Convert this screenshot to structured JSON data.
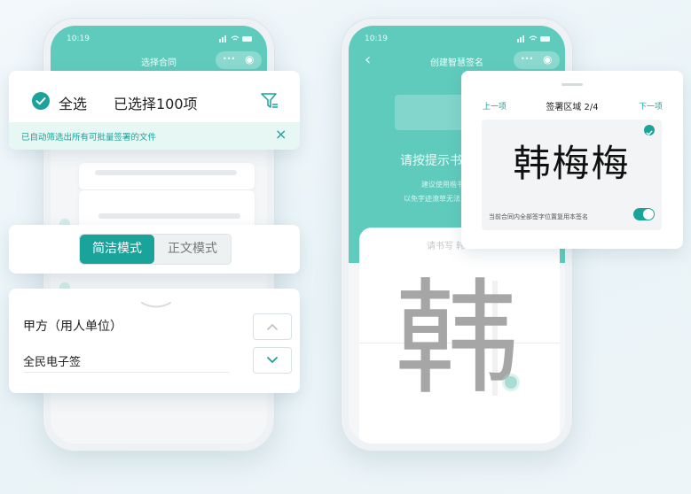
{
  "left_phone": {
    "time": "10:19",
    "title": "选择合同",
    "menu_glyph": "•••",
    "target_glyph": "◉"
  },
  "right_phone": {
    "time": "10:19",
    "back_glyph": "‹",
    "title": "创建智慧签名",
    "menu_glyph": "•••",
    "target_glyph": "◉",
    "hint_title_partial": "请按提示书写",
    "hint_line1_partial": "建议使用楷书",
    "hint_line2_partial": "以免字迹潦草无法",
    "write_label_partial": "请书写 韩",
    "big_char": "韩"
  },
  "select_card": {
    "select_all_label": "全选",
    "selected_text": "已选择100项",
    "banner_text": "已自动筛选出所有可批量签署的文件",
    "close_glyph": "×"
  },
  "mode_card": {
    "tabs": [
      {
        "label": "简洁模式",
        "active": true
      },
      {
        "label": "正文模式",
        "active": false
      }
    ]
  },
  "party_card": {
    "party_label": "甲方（用人单位）",
    "party_value": "全民电子签"
  },
  "sign_card": {
    "prev_label": "上一项",
    "area_label": "签署区域 2/4",
    "next_label": "下一项",
    "signature_text": "韩梅梅",
    "reuse_label": "当前合同内全部签字位置复用本签名",
    "reuse_on": true
  },
  "colors": {
    "accent": "#1aa39a",
    "teal_header": "#5fcbbd",
    "banner_bg": "#e6f7f4"
  }
}
